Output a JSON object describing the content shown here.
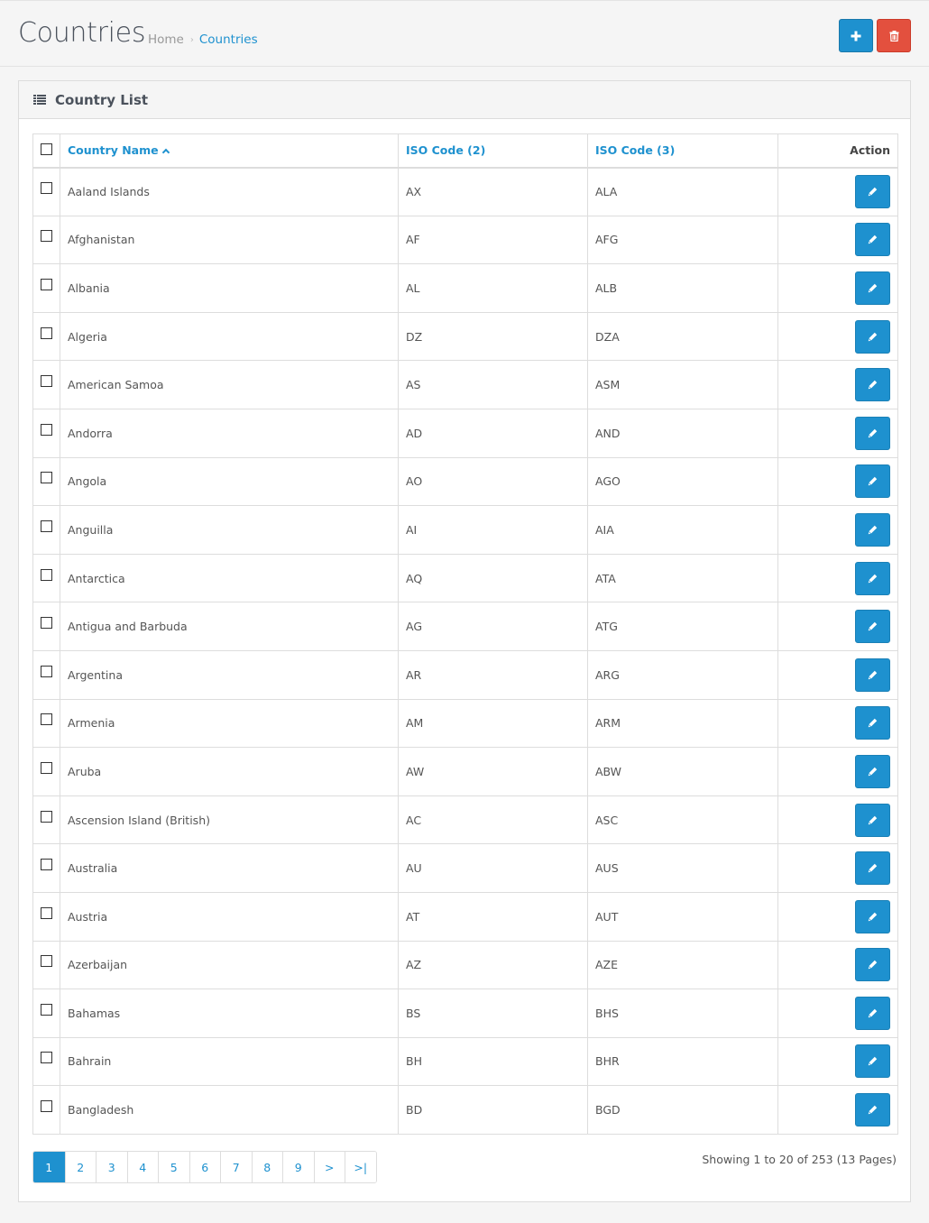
{
  "header": {
    "title": "Countries",
    "breadcrumb": [
      {
        "label": "Home"
      },
      {
        "label": "Countries"
      }
    ],
    "breadcrumb_separator": "›",
    "add_button_title": "Add New",
    "delete_button_title": "Delete"
  },
  "colors": {
    "primary": "#1e91cf",
    "danger": "#e3503e",
    "background": "#f5f5f5"
  },
  "panel": {
    "title": "Country List",
    "icon": "list-icon"
  },
  "table": {
    "columns": {
      "name": "Country Name",
      "iso2": "ISO Code (2)",
      "iso3": "ISO Code (3)",
      "action": "Action"
    },
    "sort": {
      "column": "name",
      "direction": "asc"
    },
    "rows": [
      {
        "name": "Aaland Islands",
        "iso2": "AX",
        "iso3": "ALA"
      },
      {
        "name": "Afghanistan",
        "iso2": "AF",
        "iso3": "AFG"
      },
      {
        "name": "Albania",
        "iso2": "AL",
        "iso3": "ALB"
      },
      {
        "name": "Algeria",
        "iso2": "DZ",
        "iso3": "DZA"
      },
      {
        "name": "American Samoa",
        "iso2": "AS",
        "iso3": "ASM"
      },
      {
        "name": "Andorra",
        "iso2": "AD",
        "iso3": "AND"
      },
      {
        "name": "Angola",
        "iso2": "AO",
        "iso3": "AGO"
      },
      {
        "name": "Anguilla",
        "iso2": "AI",
        "iso3": "AIA"
      },
      {
        "name": "Antarctica",
        "iso2": "AQ",
        "iso3": "ATA"
      },
      {
        "name": "Antigua and Barbuda",
        "iso2": "AG",
        "iso3": "ATG"
      },
      {
        "name": "Argentina",
        "iso2": "AR",
        "iso3": "ARG"
      },
      {
        "name": "Armenia",
        "iso2": "AM",
        "iso3": "ARM"
      },
      {
        "name": "Aruba",
        "iso2": "AW",
        "iso3": "ABW"
      },
      {
        "name": "Ascension Island (British)",
        "iso2": "AC",
        "iso3": "ASC"
      },
      {
        "name": "Australia",
        "iso2": "AU",
        "iso3": "AUS"
      },
      {
        "name": "Austria",
        "iso2": "AT",
        "iso3": "AUT"
      },
      {
        "name": "Azerbaijan",
        "iso2": "AZ",
        "iso3": "AZE"
      },
      {
        "name": "Bahamas",
        "iso2": "BS",
        "iso3": "BHS"
      },
      {
        "name": "Bahrain",
        "iso2": "BH",
        "iso3": "BHR"
      },
      {
        "name": "Bangladesh",
        "iso2": "BD",
        "iso3": "BGD"
      }
    ]
  },
  "pagination": {
    "current_page": 1,
    "pages": [
      "1",
      "2",
      "3",
      "4",
      "5",
      "6",
      "7",
      "8",
      "9",
      ">",
      ">|"
    ],
    "summary": "Showing 1 to 20 of 253 (13 Pages)"
  }
}
